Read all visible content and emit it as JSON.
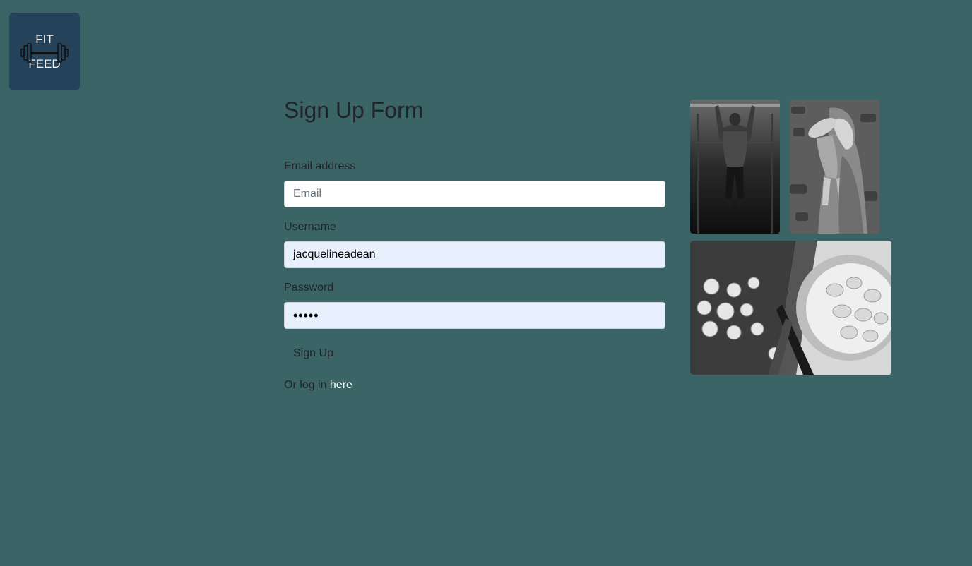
{
  "logo": {
    "line1": "FIT",
    "line2": "FEED",
    "icon": "barbell-icon"
  },
  "form": {
    "title": "Sign Up Form",
    "email_label": "Email address",
    "email_placeholder": "Email",
    "email_value": "",
    "username_label": "Username",
    "username_value": "jacquelineadean",
    "password_label": "Password",
    "password_value": "•••••",
    "submit_label": "Sign Up",
    "login_prefix": "Or log in ",
    "login_link": "here"
  },
  "photos": [
    {
      "name": "pullup-athlete-photo"
    },
    {
      "name": "mother-child-photo"
    },
    {
      "name": "mushrooms-cutting-board-photo"
    }
  ],
  "colors": {
    "background": "#3a6466",
    "logo_bg": "#24425a",
    "autofill": "#e8f0fe"
  }
}
